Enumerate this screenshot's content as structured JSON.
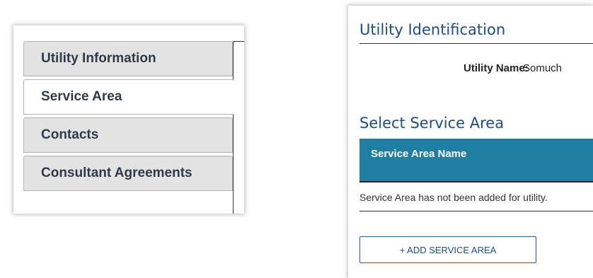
{
  "nav": {
    "tabs": [
      {
        "label": "Utility Information",
        "active": false
      },
      {
        "label": "Service Area",
        "active": true
      },
      {
        "label": "Contacts",
        "active": false
      },
      {
        "label": "Consultant Agreements",
        "active": false
      }
    ]
  },
  "identification": {
    "title": "Utility Identification",
    "utility_name_label": "Utility Name:",
    "utility_name_value": "Somuch"
  },
  "service_area": {
    "title": "Select Service Area",
    "column_header": "Service Area Name",
    "empty_message": "Service Area has not been added for utility.",
    "add_button_label": "+ ADD SERVICE AREA"
  },
  "colors": {
    "header_blue": "#1f7ea1",
    "title_blue": "#1c4e86",
    "tab_gray": "#e3e3e3"
  }
}
